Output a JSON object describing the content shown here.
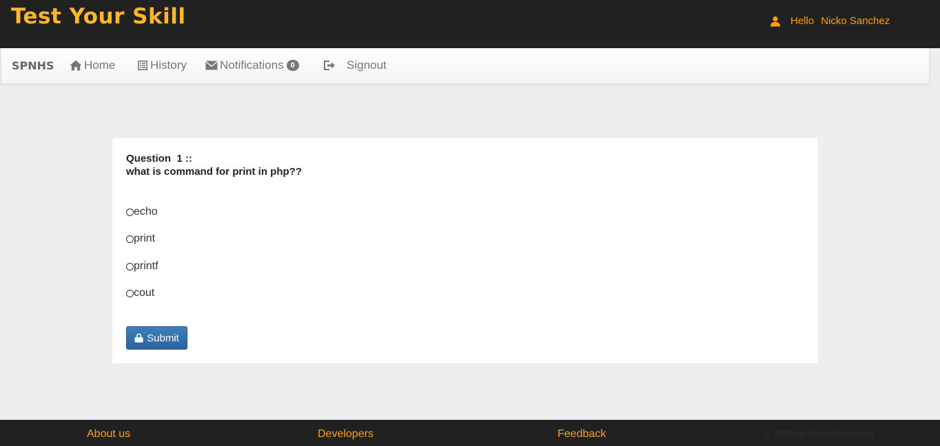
{
  "header": {
    "logo": "Test Your Skill",
    "greeting": "Hello",
    "username": "Nicko Sanchez",
    "accent_color": "#ffb52e"
  },
  "nav": {
    "brand": "SPNHS",
    "items": [
      {
        "label": "Home",
        "icon": "home-icon"
      },
      {
        "label": "History",
        "icon": "list-icon"
      },
      {
        "label": "Notifications",
        "icon": "envelope-icon",
        "badge": "0"
      },
      {
        "label": "Signout",
        "icon": "logout-icon"
      }
    ]
  },
  "quiz": {
    "question_number": "Question  1 ::",
    "question_text": "what is command for print in php??",
    "options": [
      "echo",
      "print",
      "printf",
      "cout"
    ],
    "submit_label": "Submit",
    "submit_color": "#2a649b"
  },
  "footer": {
    "links": [
      "About us",
      "Developers",
      "Feedback"
    ],
    "copyright": "© 2020 All Rights Reserved.",
    "link_color": "#ff9c22"
  }
}
